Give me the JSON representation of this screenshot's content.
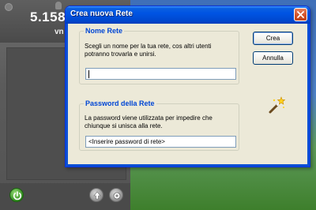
{
  "background_app": {
    "ip_address": "5.158.1",
    "nickname": "vn"
  },
  "dialog": {
    "title": "Crea nuova Rete",
    "network_name": {
      "group_title": "Nome Rete",
      "description": "Scegli un nome per la tua rete, cos altri utenti potranno trovarla e unirsi.",
      "value": ""
    },
    "password": {
      "group_title": "Password della Rete",
      "description": "La password viene utilizzata per impedire che chiunque si unisca alla rete.",
      "value": "<Inserire password di rete>"
    },
    "buttons": {
      "create": "Crea",
      "cancel": "Annulla"
    }
  },
  "icons": {
    "close": "close-icon",
    "wizard": "magic-wand-icon",
    "power": "power-icon",
    "upload": "upload-icon",
    "settings": "settings-icon"
  },
  "colors": {
    "titlebar": "#0054e3",
    "group_title": "#0046d5",
    "dialog_bg": "#ece9d8"
  }
}
